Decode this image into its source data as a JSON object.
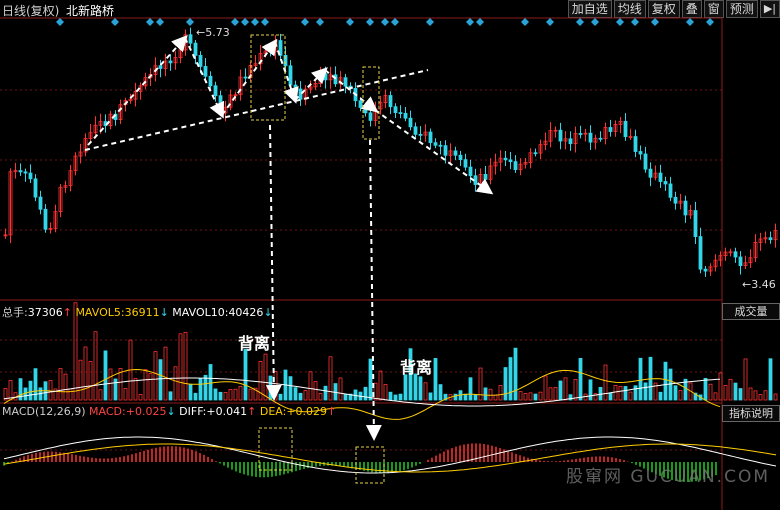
{
  "header": {
    "period": "日线(复权)",
    "stock_name": "北新路桥",
    "buttons": [
      "加自选",
      "均线",
      "复权",
      "叠",
      "窗",
      "预测"
    ],
    "nav_icon": "skip-forward-icon"
  },
  "price_panel": {
    "high_label": "5.73",
    "low_label": "3.46",
    "annotation_marker": "diamond-icon",
    "up_color": "#ff3333",
    "down_color": "#33d6e8"
  },
  "volume_panel": {
    "total_label": "总手:",
    "total_value": "37306",
    "total_arrow": "↑",
    "mavol5_label": "MAVOL5:",
    "mavol5_value": "36911",
    "mavol5_arrow": "↓",
    "mavol10_label": "MAVOL10:",
    "mavol10_value": "40426",
    "mavol10_arrow": "↓",
    "button": "成交量"
  },
  "macd_panel": {
    "name": "MACD(12,26,9)",
    "macd_label": "MACD:",
    "macd_value": "+0.025",
    "macd_arrow": "↓",
    "diff_label": "DIFF:",
    "diff_value": "+0.041",
    "diff_arrow": "↑",
    "dea_label": "DEA:",
    "dea_value": "+0.029",
    "dea_arrow": "↑",
    "button": "指标说明"
  },
  "annotations": {
    "divergence_1": "背离",
    "divergence_2": "背离"
  },
  "watermark": "股窜网 GUCUAN.COM"
}
